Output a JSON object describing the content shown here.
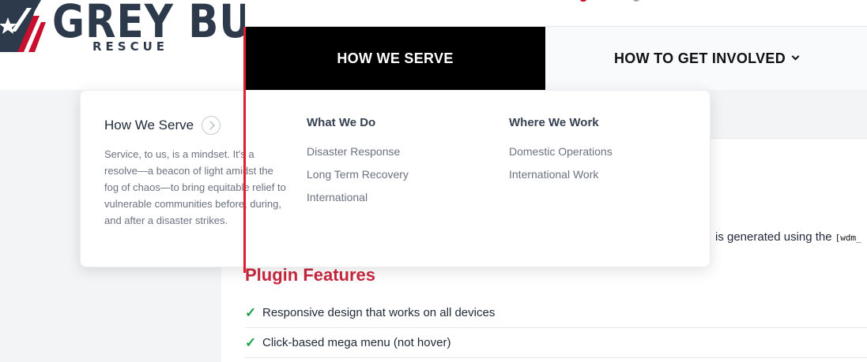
{
  "brand": {
    "name": "GREY BULL",
    "sub": "RESCUE",
    "colors": {
      "navy": "#2d3a4c",
      "red": "#c8102e"
    }
  },
  "nav": {
    "items": [
      {
        "label": "HOW WE SERVE",
        "active": true
      },
      {
        "label": "HOW TO GET INVOLVED",
        "icon": "chevron-down-icon"
      }
    ]
  },
  "mega_menu": {
    "title": "How We Serve",
    "title_icon": "arrow-circle-right-icon",
    "description": "Service, to us, is a mindset. It's a resolve—a beacon of light amidst the fog of chaos—to bring equitable relief to vulnerable communities before, during, and after a disaster strikes.",
    "columns": [
      {
        "heading": "What We Do",
        "links": [
          "Disaster Response",
          "Long Term Recovery",
          "International"
        ]
      },
      {
        "heading": "Where We Work",
        "links": [
          "Domestic Operations",
          "International Work"
        ]
      }
    ]
  },
  "content": {
    "paragraph_fragment": "is generated using the",
    "code_fragment": "[wdm_",
    "plugin_title": "Plugin Features",
    "features": [
      "Responsive design that works on all devices",
      "Click-based mega menu (not hover)"
    ],
    "check_icon": "checkmark-icon",
    "accent": "#c8273e",
    "check_color": "#16a34a"
  }
}
